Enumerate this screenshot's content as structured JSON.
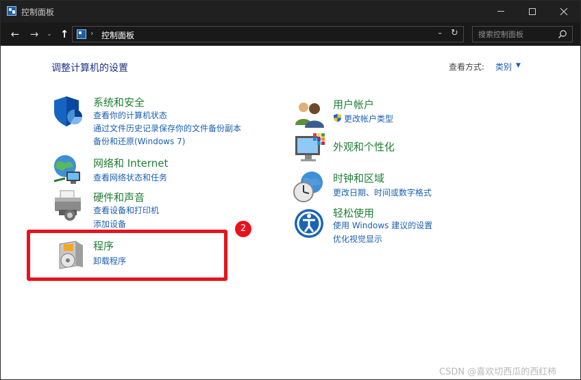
{
  "window": {
    "title": "控制面板"
  },
  "nav": {
    "back_glyph": "←",
    "forward_glyph": "→",
    "recent_glyph": "⌄",
    "up_glyph": "↑",
    "address_separator": "›",
    "address_text": "控制面板",
    "address_dropdown_glyph": "⌄",
    "refresh_glyph": "↻",
    "search_placeholder": "搜索控制面板"
  },
  "content": {
    "page_title": "调整计算机的设置",
    "view_by_label": "查看方式:",
    "view_by_value": "类别",
    "view_by_arrow": "▼"
  },
  "categories_left": [
    {
      "icon": "security-shield-icon",
      "title": "系统和安全",
      "links": [
        "查看你的计算机状态",
        "通过文件历史记录保存你的文件备份副本",
        "备份和还原(Windows 7)"
      ]
    },
    {
      "icon": "network-globe-icon",
      "title": "网络和 Internet",
      "links": [
        "查看网络状态和任务"
      ]
    },
    {
      "icon": "printer-icon",
      "title": "硬件和声音",
      "links": [
        "查看设备和打印机",
        "添加设备"
      ]
    },
    {
      "icon": "program-disc-icon",
      "title": "程序",
      "links": [
        "卸载程序"
      ]
    }
  ],
  "categories_right": [
    {
      "icon": "user-accounts-icon",
      "title": "用户帐户",
      "links": [
        "更改帐户类型"
      ]
    },
    {
      "icon": "appearance-monitor-icon",
      "title": "外观和个性化",
      "links": []
    },
    {
      "icon": "clock-globe-icon",
      "title": "时钟和区域",
      "links": [
        "更改日期、时间或数字格式"
      ]
    },
    {
      "icon": "ease-of-access-icon",
      "title": "轻松使用",
      "links": [
        "使用 Windows 建议的设置",
        "优化视觉显示"
      ]
    }
  ],
  "annotation": {
    "step_number": "2",
    "highlight_color": "#e8121d"
  },
  "watermark": "CSDN @喜欢切西瓜的西红柿",
  "colors": {
    "title_bar": "#202020",
    "nav_bar": "#191919",
    "category_title": "#1e7e34",
    "link": "#1a5fb4",
    "page_title": "#1e3287"
  }
}
